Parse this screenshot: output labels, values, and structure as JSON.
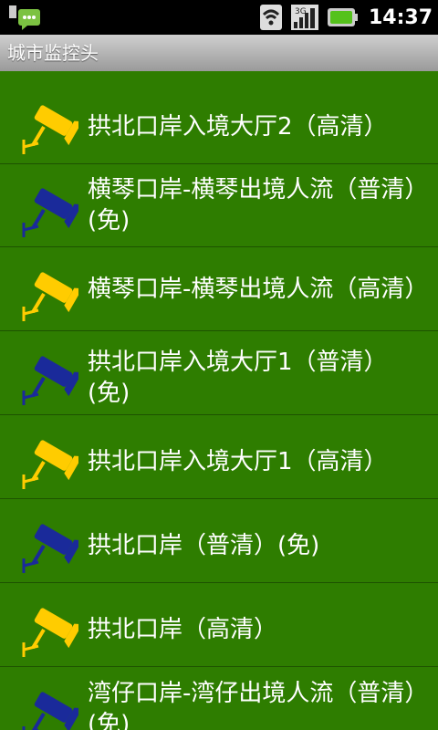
{
  "status": {
    "time": "14:37",
    "network": "3G"
  },
  "app": {
    "title": "城市监控头"
  },
  "colors": {
    "background": "#2e7d00",
    "camera_hd": "#ffcc00",
    "camera_sd": "#1a2a9a"
  },
  "cameras": [
    {
      "label": "拱北口岸入境大厅2（高清）",
      "icon": "yellow-camera-icon"
    },
    {
      "label": "横琴口岸-横琴出境人流（普清）(免)",
      "icon": "blue-camera-icon"
    },
    {
      "label": "横琴口岸-横琴出境人流（高清）",
      "icon": "yellow-camera-icon"
    },
    {
      "label": "拱北口岸入境大厅1（普清）(免)",
      "icon": "blue-camera-icon"
    },
    {
      "label": "拱北口岸入境大厅1（高清）",
      "icon": "yellow-camera-icon"
    },
    {
      "label": "拱北口岸（普清）(免)",
      "icon": "blue-camera-icon"
    },
    {
      "label": "拱北口岸（高清）",
      "icon": "yellow-camera-icon"
    },
    {
      "label": "湾仔口岸-湾仔出境人流（普清）(免)",
      "icon": "blue-camera-icon"
    }
  ]
}
